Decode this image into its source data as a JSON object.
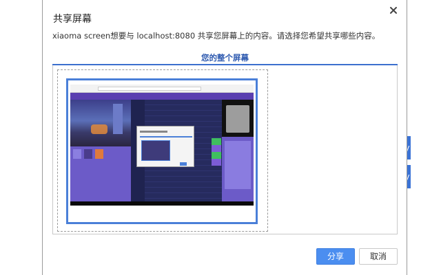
{
  "backdrop": {
    "tab_a": "y",
    "tab_b": "y"
  },
  "dialog": {
    "title": "共享屏幕",
    "description": "xiaoma screen想要与 localhost:8080 共享您屏幕上的内容。请选择您希望共享哪些内容。",
    "tab_label": "您的整个屏幕",
    "share_label": "分享",
    "cancel_label": "取消",
    "close_icon": "close-icon"
  },
  "colors": {
    "accent": "#3b6fce",
    "share_button": "#4b8ef0",
    "selection_border": "#4a7fd8"
  }
}
